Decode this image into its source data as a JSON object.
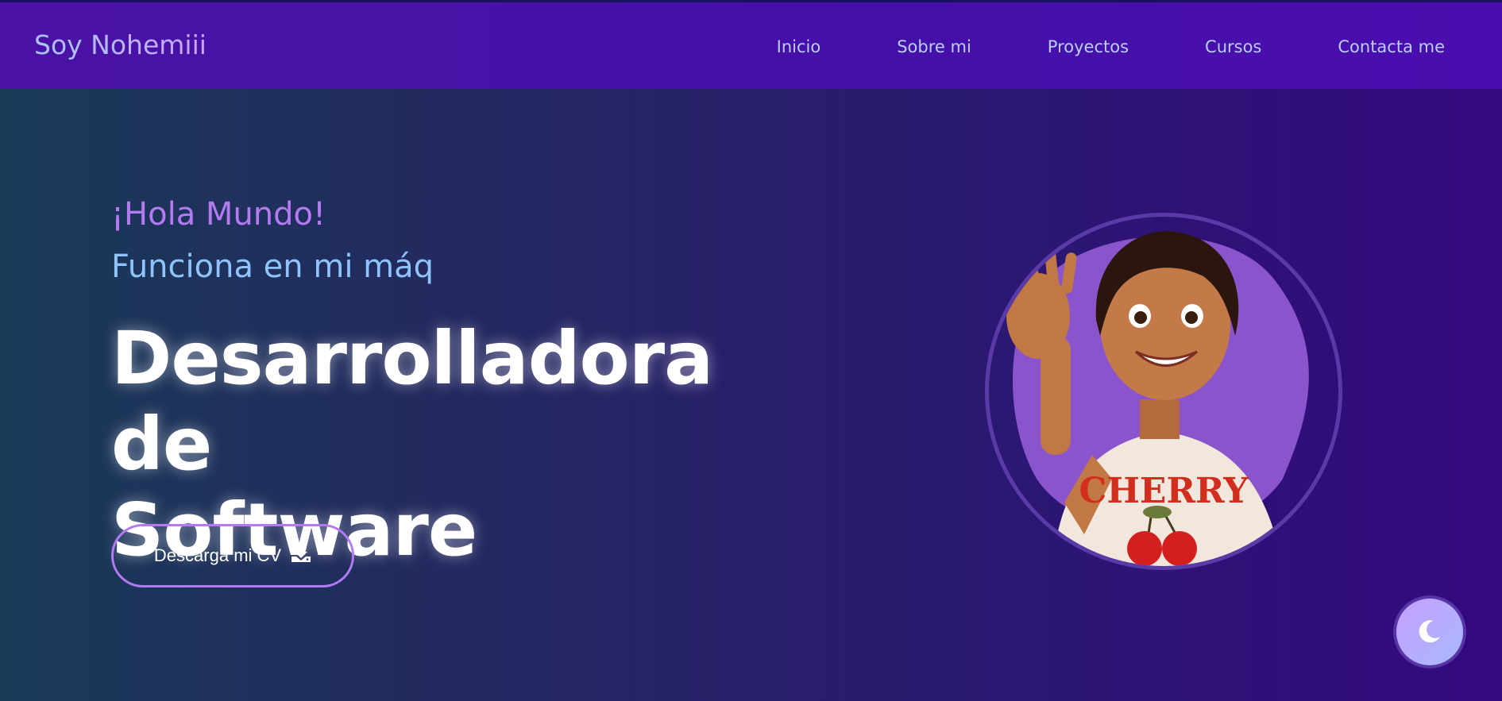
{
  "navbar": {
    "brand": "Soy Nohemiii",
    "links": [
      "Inicio",
      "Sobre mi",
      "Proyectos",
      "Cursos",
      "Contacta me"
    ]
  },
  "hero": {
    "greeting": "¡Hola Mundo!",
    "tagline": "Funciona en mi máq",
    "headline_line1": "Desarrolladora de",
    "headline_line2": "Software",
    "cv_button_label": "Descarga mi CV",
    "cv_icon": "download-icon",
    "avatar_shirt_text": "CHERRY",
    "avatar_icon": "cartoon-girl-waving-avatar"
  },
  "theme_toggle": {
    "icon": "moon-icon"
  },
  "colors": {
    "navbar": "#4712a8",
    "accent_purple": "#b47af2",
    "accent_blue": "#8fc4ff",
    "headline": "#ffffff"
  }
}
